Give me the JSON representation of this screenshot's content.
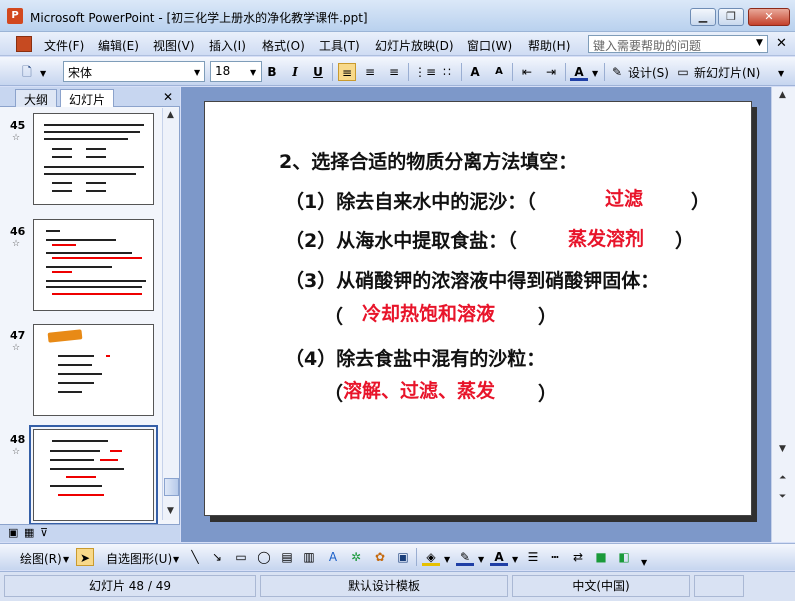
{
  "window": {
    "title": "Microsoft PowerPoint - [初三化学上册水的净化教学课件.ppt]",
    "app_icon": "powerpoint-icon"
  },
  "menu": {
    "items": [
      "文件(F)",
      "编辑(E)",
      "视图(V)",
      "插入(I)",
      "格式(O)",
      "工具(T)",
      "幻灯片放映(D)",
      "窗口(W)",
      "帮助(H)"
    ],
    "help_placeholder": "键入需要帮助的问题"
  },
  "format_toolbar": {
    "font": "宋体",
    "size": "18",
    "bold": "B",
    "italic": "I",
    "underline": "U",
    "design_label": "设计(S)",
    "new_slide_label": "新幻灯片(N)"
  },
  "left_pane": {
    "tabs": [
      "大纲",
      "幻灯片"
    ],
    "thumbnails": [
      {
        "number": "45",
        "selected": false
      },
      {
        "number": "46",
        "selected": false
      },
      {
        "number": "47",
        "selected": false
      },
      {
        "number": "48",
        "selected": true
      }
    ]
  },
  "slide": {
    "heading": "2、选择合适的物质分离方法填空：",
    "q1": {
      "text": "（1）除去自来水中的泥沙：（",
      "answer": "过滤",
      "close": "）"
    },
    "q2": {
      "text": "（2）从海水中提取食盐：（",
      "answer": "蒸发溶剂",
      "close": "）"
    },
    "q3": {
      "text": "（3）从硝酸钾的浓溶液中得到硝酸钾固体：",
      "open": "（",
      "answer": "冷却热饱和溶液",
      "close": "）"
    },
    "q4": {
      "text": "（4）除去食盐中混有的沙粒：",
      "open": "（",
      "answer": "溶解、过滤、蒸发",
      "close": "）"
    }
  },
  "draw_toolbar": {
    "draw_label": "绘图(R)",
    "autoshapes_label": "自选图形(U)"
  },
  "status": {
    "slide_pos": "幻灯片 48 / 49",
    "template": "默认设计模板",
    "language": "中文(中国)"
  },
  "colors": {
    "answer_red": "#e8142a",
    "selection_blue": "#355fa7"
  }
}
